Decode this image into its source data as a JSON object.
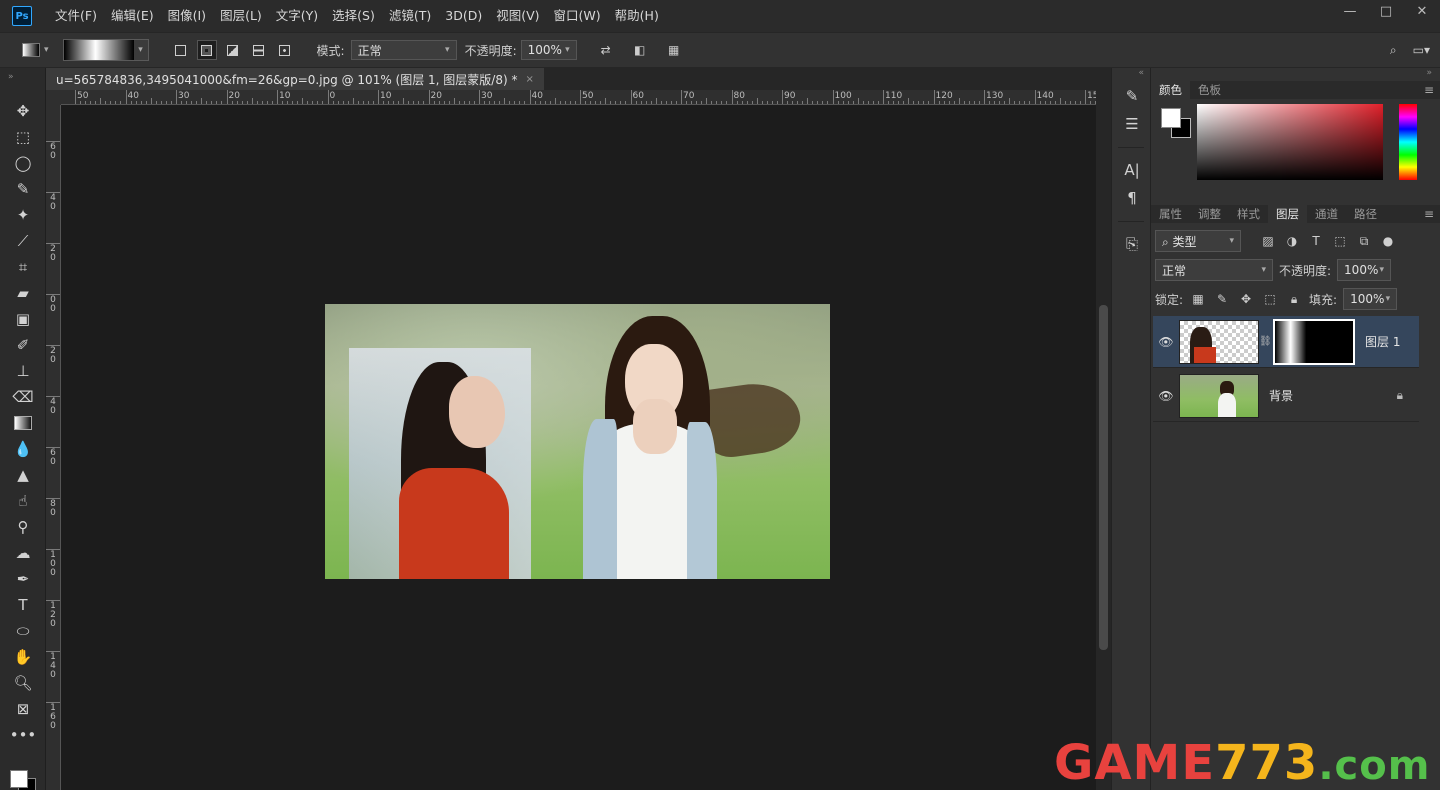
{
  "app": {
    "logo": "Ps"
  },
  "menu": [
    "文件(F)",
    "编辑(E)",
    "图像(I)",
    "图层(L)",
    "文字(Y)",
    "选择(S)",
    "滤镜(T)",
    "3D(D)",
    "视图(V)",
    "窗口(W)",
    "帮助(H)"
  ],
  "window_controls": {
    "minimize": "—",
    "maximize": "□",
    "close": "✕"
  },
  "options": {
    "mode_label": "模式:",
    "mode_value": "正常",
    "opacity_label": "不透明度:",
    "opacity_value": "100%"
  },
  "document": {
    "tab_title": "u=565784836,3495041000&fm=26&gp=0.jpg @ 101% (图层 1, 图层蒙版/8) *",
    "close": "×"
  },
  "ruler": {
    "h_labels": [
      "50",
      "40",
      "30",
      "20",
      "10",
      "0",
      "10",
      "20",
      "30",
      "40",
      "50",
      "60",
      "70",
      "80",
      "90",
      "100",
      "110",
      "120",
      "130",
      "140",
      "15"
    ],
    "v_labels": [
      "6",
      "4",
      "2",
      "0",
      "2",
      "4",
      "6",
      "8",
      "10",
      "12",
      "14",
      "16"
    ]
  },
  "panels": {
    "color_tabs": [
      "颜色",
      "色板"
    ],
    "layer_tabs": [
      "属性",
      "调整",
      "样式",
      "图层",
      "通道",
      "路径"
    ],
    "filter_label": "类型",
    "blend_mode": "正常",
    "opacity_label": "不透明度:",
    "opacity_value": "100%",
    "lock_label": "锁定:",
    "fill_label": "填充:",
    "fill_value": "100%",
    "layers": [
      {
        "name": "图层 1",
        "selected": true
      },
      {
        "name": "背景",
        "selected": false
      }
    ]
  },
  "watermark": {
    "game": "GAME",
    "num": "773",
    "com": ".com"
  },
  "icons": {
    "tools": [
      "move-icon",
      "marquee-icon",
      "lasso-icon",
      "quick-select-icon",
      "magic-wand-icon",
      "eyedropper-icon",
      "crop-icon",
      "healing-icon",
      "frame-icon",
      "brush-icon",
      "stamp-icon",
      "eraser-icon",
      "gradient-icon",
      "blur-icon",
      "dodge-icon",
      "smudge-icon",
      "burn-icon",
      "sponge-icon",
      "pen-icon",
      "type-icon",
      "ellipse-icon",
      "hand-icon",
      "zoom-icon",
      "artboard-icon",
      "more-icon"
    ]
  }
}
